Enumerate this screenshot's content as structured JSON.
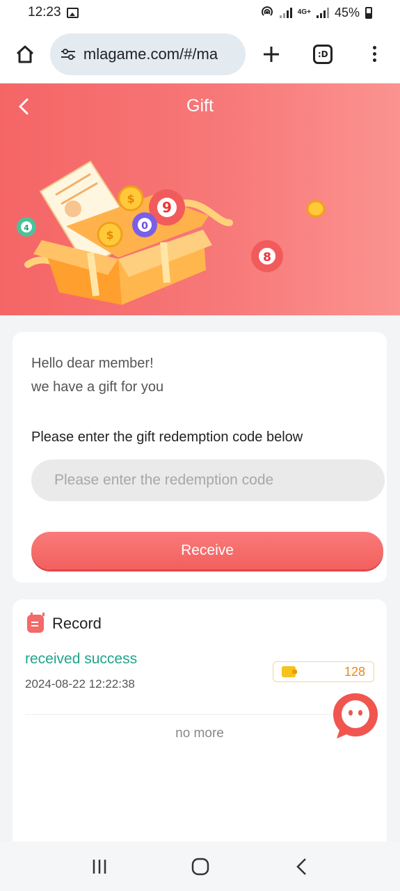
{
  "status_bar": {
    "time": "12:23",
    "network": "4G+",
    "battery": "45%"
  },
  "browser": {
    "url": "mlagame.com/#/ma",
    "tabs_label": ":D"
  },
  "header": {
    "title": "Gift"
  },
  "banner": {
    "balls": [
      "9",
      "0",
      "4",
      "8"
    ]
  },
  "gift_card": {
    "greeting_line1": "Hello dear member!",
    "greeting_line2": "we have a gift for you",
    "prompt": "Please enter the gift redemption code below",
    "input_placeholder": "Please enter the redemption code",
    "input_value": "",
    "receive_label": "Receive"
  },
  "record": {
    "title": "Record",
    "items": [
      {
        "status": "received success",
        "time": "2024-08-22 12:22:38",
        "amount": "128"
      }
    ],
    "end_text": "no more"
  },
  "colors": {
    "brand": "#f56566",
    "success": "#1fa58b",
    "amount": "#e8871e"
  }
}
